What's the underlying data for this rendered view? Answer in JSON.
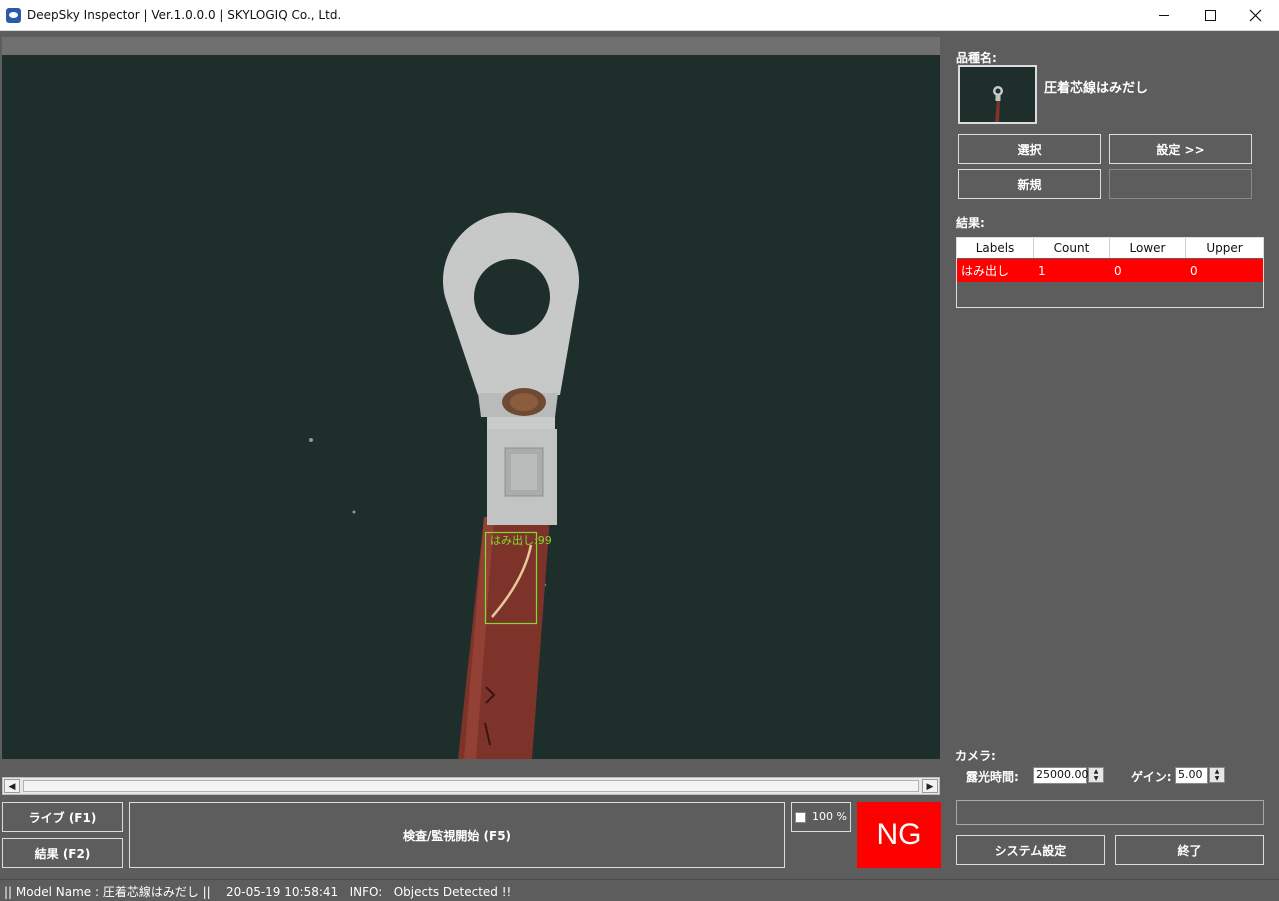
{
  "window": {
    "title": "DeepSky Inspector | Ver.1.0.0.0 | SKYLOGIQ Co., Ltd.",
    "controls": {
      "minimize": "—",
      "maximize": "☐",
      "close": "✕"
    }
  },
  "viewer": {
    "detection": {
      "label": "はみ出し",
      "score": ":99"
    },
    "scroll": {
      "left": "◀",
      "right": "▶"
    }
  },
  "controls": {
    "live_button": "ライブ (F1)",
    "result_button": "結果 (F2)",
    "inspect_button": "検査/監視開始 (F5)",
    "zoom_label": "100 %",
    "verdict": "NG"
  },
  "side_panel": {
    "model_label": "品種名:",
    "model_name": "圧着芯線はみだし",
    "select_button": "選択",
    "settings_button": "設定 >>",
    "new_button": "新規",
    "results_label": "結果:",
    "table": {
      "headers": [
        "Labels",
        "Count",
        "Lower",
        "Upper"
      ],
      "rows": [
        [
          "はみ出し",
          "1",
          "0",
          "0"
        ]
      ]
    },
    "camera_label": "カメラ:",
    "exposure_label": "露光時間:",
    "exposure_value": "25000.00",
    "gain_label": "ゲイン:",
    "gain_value": "5.00",
    "system_button": "システム設定",
    "exit_button": "終了"
  },
  "status_bar": {
    "text": "|| Model Name : 圧着芯線はみだし ||    20-05-19 10:58:41   INFO:   Objects Detected !!"
  }
}
